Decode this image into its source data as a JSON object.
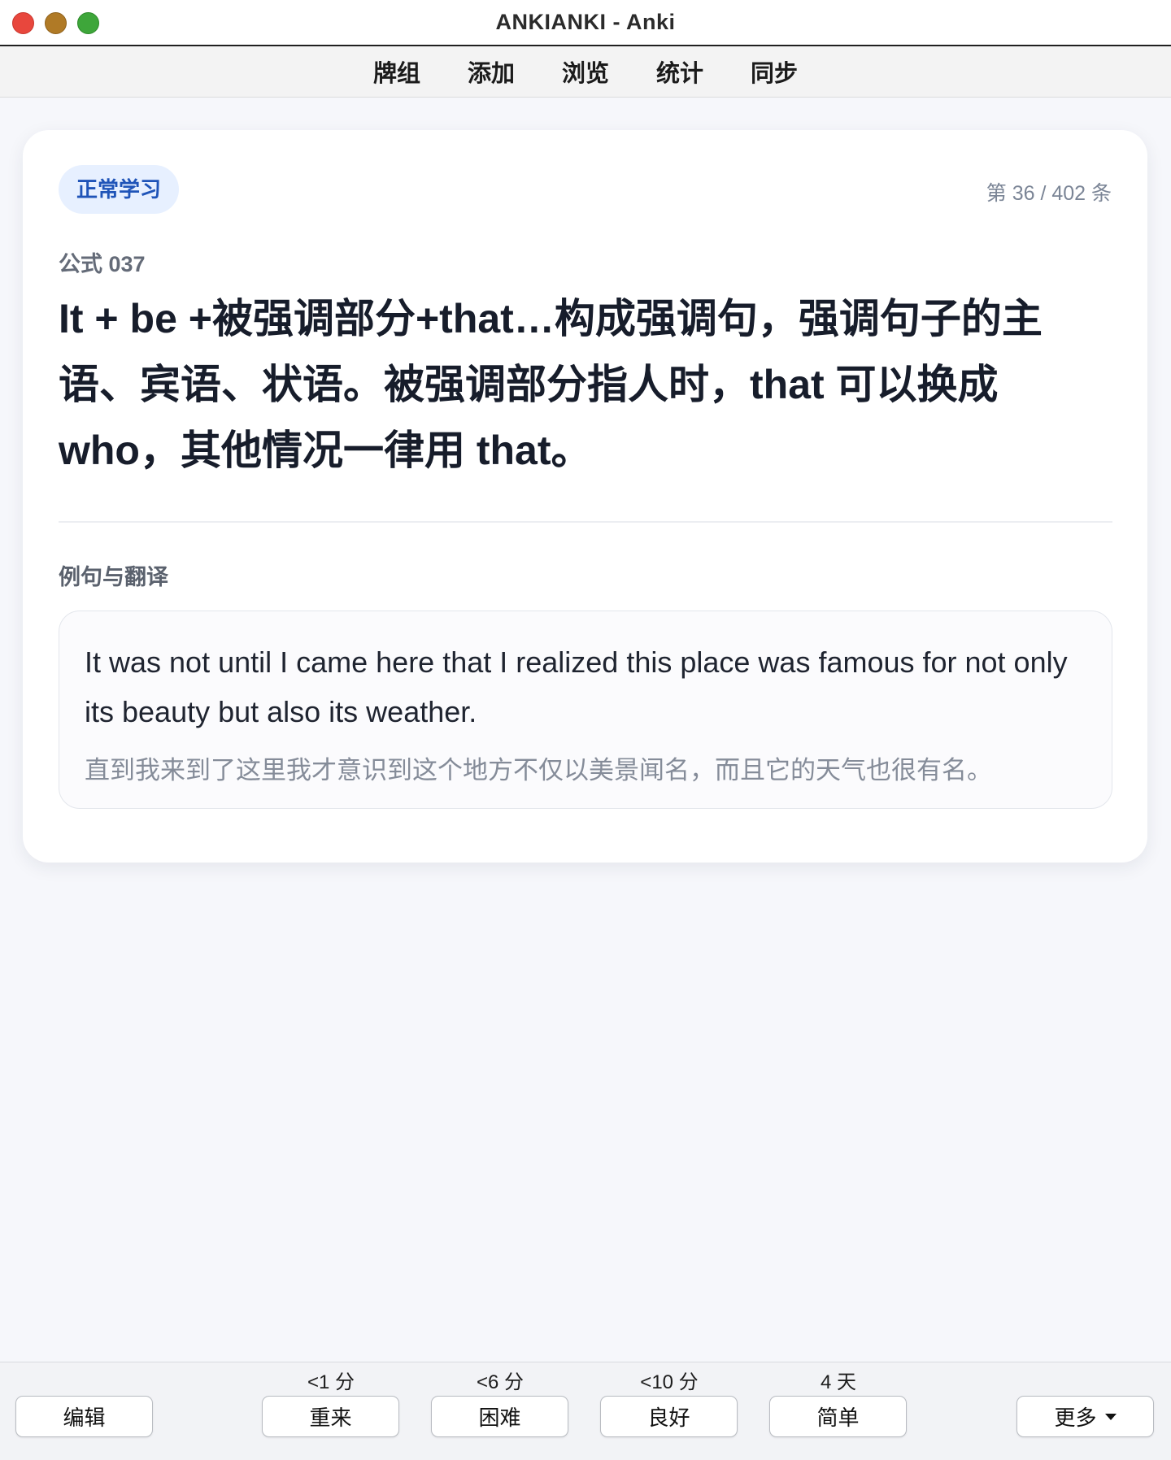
{
  "window": {
    "title": "ANKIANKI - Anki"
  },
  "menu": {
    "items": [
      "牌组",
      "添加",
      "浏览",
      "统计",
      "同步"
    ]
  },
  "card": {
    "mode_badge": "正常学习",
    "progress": "第 36 / 402 条",
    "formula_id": "公式 037",
    "front": "It + be +被强调部分+that…构成强调句，强调句子的主语、宾语、状语。被强调部分指人时，that 可以换成 who，其他情况一律用 that。",
    "example_heading": "例句与翻译",
    "example_en": "It was not until I came here that I realized this place was famous for not only its beauty but also its weather.",
    "example_zh": "直到我来到了这里我才意识到这个地方不仅以美景闻名，而且它的天气也很有名。"
  },
  "bottom": {
    "edit": "编辑",
    "more": "更多",
    "answers": [
      {
        "interval": "<1 分",
        "label": "重来"
      },
      {
        "interval": "<6 分",
        "label": "困难"
      },
      {
        "interval": "<10 分",
        "label": "良好"
      },
      {
        "interval": "4 天",
        "label": "简单"
      }
    ]
  },
  "colors": {
    "accent_badge_bg": "#e7f0ff",
    "accent_badge_text": "#1f54b8",
    "page_bg": "#f6f7fb",
    "close": "#e8473d",
    "minimize": "#b07a26",
    "zoom": "#3ea63a"
  }
}
